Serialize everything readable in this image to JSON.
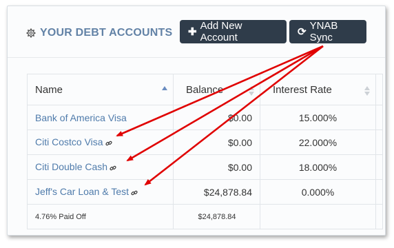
{
  "header": {
    "title": "YOUR DEBT ACCOUNTS",
    "add_button": "Add New Account",
    "sync_button": "YNAB Sync"
  },
  "table": {
    "columns": [
      "Name",
      "Balance",
      "Interest Rate"
    ],
    "rows": [
      {
        "name": "Bank of America Visa",
        "balance": "$0.00",
        "rate": "15.000%",
        "linked": false
      },
      {
        "name": "Citi Costco Visa",
        "balance": "$0.00",
        "rate": "22.000%",
        "linked": true
      },
      {
        "name": "Citi Double Cash",
        "balance": "$0.00",
        "rate": "18.000%",
        "linked": true
      },
      {
        "name": "Jeff's Car Loan & Test",
        "balance": "$24,878.84",
        "rate": "0.000%",
        "linked": true
      }
    ],
    "footer": {
      "paid_off": "4.76% Paid Off",
      "total": "$24,878.84"
    }
  },
  "colors": {
    "accent": "#6282a6",
    "button": "#2f3c4a",
    "arrow": "#e00000",
    "link": "#4f7bab"
  }
}
